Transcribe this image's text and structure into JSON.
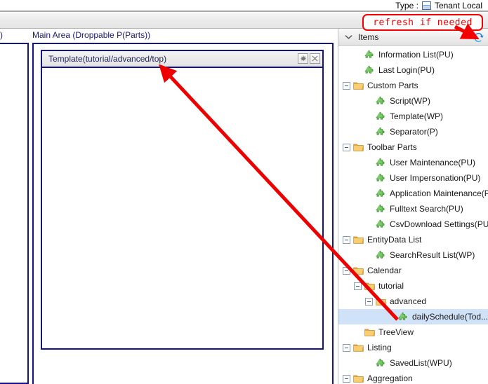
{
  "topbar": {
    "type_label": "Type :",
    "type_icon": "document-icon",
    "type_value": "Tenant Local"
  },
  "left_panel": {
    "label": ")"
  },
  "main_area": {
    "label": "Main Area (Droppable P(Parts))",
    "part": {
      "title": "Template(tutorial/advanced/top)",
      "settings_icon": "gear-icon",
      "close_icon": "close-icon"
    }
  },
  "items_panel": {
    "collapse_icon": "chevron-down-icon",
    "title": "Items",
    "refresh_icon": "refresh-icon",
    "tree": [
      {
        "label": "Information List(PU)",
        "icon": "puzzle-icon",
        "depth": 1,
        "toggle": "none",
        "selected": false
      },
      {
        "label": "Last Login(PU)",
        "icon": "puzzle-icon",
        "depth": 1,
        "toggle": "none",
        "selected": false
      },
      {
        "label": "Custom Parts",
        "icon": "folder-icon",
        "depth": 0,
        "toggle": "minus",
        "selected": false
      },
      {
        "label": "Script(WP)",
        "icon": "puzzle-icon",
        "depth": 2,
        "toggle": "none",
        "selected": false
      },
      {
        "label": "Template(WP)",
        "icon": "puzzle-icon",
        "depth": 2,
        "toggle": "none",
        "selected": false
      },
      {
        "label": "Separator(P)",
        "icon": "puzzle-icon",
        "depth": 2,
        "toggle": "none",
        "selected": false
      },
      {
        "label": "Toolbar Parts",
        "icon": "folder-icon",
        "depth": 0,
        "toggle": "minus",
        "selected": false
      },
      {
        "label": "User Maintenance(PU)",
        "icon": "puzzle-icon",
        "depth": 2,
        "toggle": "none",
        "selected": false
      },
      {
        "label": "User Impersonation(PU)",
        "icon": "puzzle-icon",
        "depth": 2,
        "toggle": "none",
        "selected": false
      },
      {
        "label": "Application Maintenance(PU)",
        "icon": "puzzle-icon",
        "depth": 2,
        "toggle": "none",
        "selected": false
      },
      {
        "label": "Fulltext Search(PU)",
        "icon": "puzzle-icon",
        "depth": 2,
        "toggle": "none",
        "selected": false
      },
      {
        "label": "CsvDownload Settings(PU)",
        "icon": "puzzle-icon",
        "depth": 2,
        "toggle": "none",
        "selected": false
      },
      {
        "label": "EntityData List",
        "icon": "folder-icon",
        "depth": 0,
        "toggle": "minus",
        "selected": false
      },
      {
        "label": "SearchResult List(WP)",
        "icon": "puzzle-icon",
        "depth": 2,
        "toggle": "none",
        "selected": false
      },
      {
        "label": "Calendar",
        "icon": "folder-icon",
        "depth": 0,
        "toggle": "minus",
        "selected": false
      },
      {
        "label": "tutorial",
        "icon": "folder-icon",
        "depth": 1,
        "toggle": "minus",
        "selected": false
      },
      {
        "label": "advanced",
        "icon": "folder-icon",
        "depth": 2,
        "toggle": "minus",
        "selected": false
      },
      {
        "label": "dailySchedule(Tod...",
        "icon": "puzzle-icon",
        "depth": 4,
        "toggle": "none",
        "selected": true
      },
      {
        "label": "TreeView",
        "icon": "folder-icon",
        "depth": 1,
        "toggle": "none",
        "selected": false
      },
      {
        "label": "Listing",
        "icon": "folder-icon",
        "depth": 0,
        "toggle": "minus",
        "selected": false
      },
      {
        "label": "SavedList(WPU)",
        "icon": "puzzle-icon",
        "depth": 2,
        "toggle": "none",
        "selected": false
      },
      {
        "label": "Aggregation",
        "icon": "folder-icon",
        "depth": 0,
        "toggle": "minus",
        "selected": false
      }
    ]
  },
  "annotations": {
    "note_text": "refresh if needed",
    "note_color": "#f40000",
    "arrow_color": "#ee0000"
  },
  "colors": {
    "panel_border": "#131384",
    "selection": "#cfe2f7",
    "folder": "#f2c14b",
    "puzzle": "#56b94c"
  }
}
